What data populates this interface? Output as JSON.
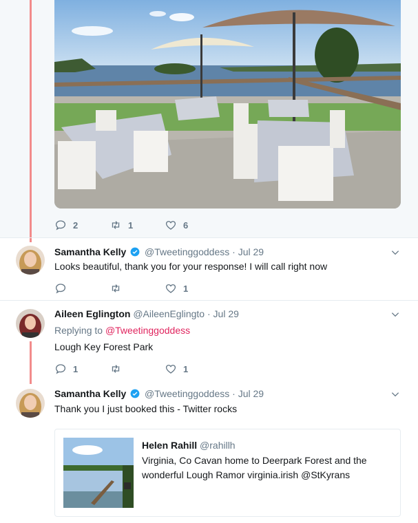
{
  "tweets": [
    {
      "actions": {
        "replies": "2",
        "retweets": "1",
        "likes": "6"
      }
    },
    {
      "name": "Samantha Kelly",
      "handle": "@Tweetinggoddess",
      "separator": "·",
      "date": "Jul 29",
      "verified": true,
      "text": "Looks beautiful, thank you for your response! I will call right now",
      "actions": {
        "replies": "",
        "retweets": "",
        "likes": "1"
      }
    },
    {
      "name": "Aileen Eglington",
      "handle": "@AileenEglingto",
      "separator": "·",
      "date": "Jul 29",
      "replying_label": "Replying to",
      "replying_to": "@Tweetinggoddess",
      "text": "Lough Key Forest Park",
      "actions": {
        "replies": "1",
        "retweets": "",
        "likes": "1"
      }
    },
    {
      "name": "Samantha Kelly",
      "handle": "@Tweetinggoddess",
      "separator": "·",
      "date": "Jul 29",
      "verified": true,
      "text": "Thank you I just booked this - Twitter rocks",
      "quote": {
        "name": "Helen Rahill",
        "handle": "@rahillh",
        "text": "Virginia, Co Cavan home to Deerpark Forest and the wonderful Lough Ramor virginia.irish @StKyrans"
      }
    }
  ],
  "icons": {
    "reply": "reply-icon",
    "retweet": "retweet-icon",
    "like": "like-icon",
    "verified": "verified-badge-icon",
    "caret": "chevron-down-icon"
  },
  "colors": {
    "thread_line": "#f28b8b",
    "verified": "#1da1f2",
    "mention": "#e0245e",
    "muted": "#657786"
  }
}
